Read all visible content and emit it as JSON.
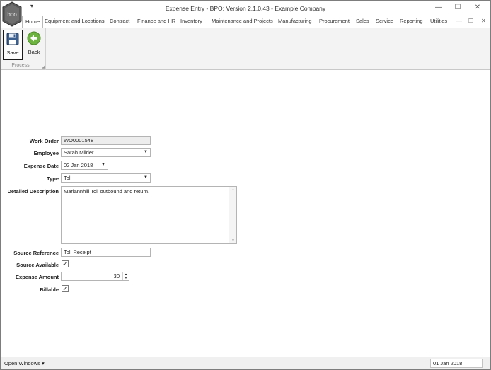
{
  "window": {
    "title": "Expense Entry - BPO: Version 2.1.0.43 - Example Company",
    "logo_text": "bpo",
    "qat_glyph": "▾",
    "minimize": "—",
    "maximize": "☐",
    "close": "✕"
  },
  "tabs": [
    "Home",
    "Equipment and Locations",
    "Contract",
    "Finance and HR",
    "Inventory",
    "Maintenance and Projects",
    "Manufacturing",
    "Procurement",
    "Sales",
    "Service",
    "Reporting",
    "Utilities"
  ],
  "mdi": {
    "minimize": "—",
    "restore": "❐",
    "close": "✕"
  },
  "ribbon": {
    "save_label": "Save",
    "back_label": "Back",
    "group_label": "Process",
    "launcher": "◢"
  },
  "form": {
    "work_order": {
      "label": "Work Order",
      "value": "WO0001548"
    },
    "employee": {
      "label": "Employee",
      "value": "Sarah Milder"
    },
    "expense_date": {
      "label": "Expense Date",
      "value": "02 Jan 2018"
    },
    "type": {
      "label": "Type",
      "value": "Toll"
    },
    "description": {
      "label": "Detailed Description",
      "value": "Mariannhill Toll outbound and return."
    },
    "source_reference": {
      "label": "Source Reference",
      "value": "Toll Receipt"
    },
    "source_available": {
      "label": "Source Available",
      "checked": true,
      "glyph": "✓"
    },
    "expense_amount": {
      "label": "Expense Amount",
      "value": "30"
    },
    "billable": {
      "label": "Billable",
      "checked": true,
      "glyph": "✓"
    },
    "dropdown_glyph": "▼",
    "spin_up": "▲",
    "spin_down": "▼",
    "scroll_up": "▲",
    "scroll_down": "▼"
  },
  "statusbar": {
    "open_windows": "Open Windows ▾",
    "date": "01 Jan 2018"
  },
  "colors": {
    "accent_green": "#6cb33f",
    "save_icon_blue": "#3b5f8f"
  }
}
